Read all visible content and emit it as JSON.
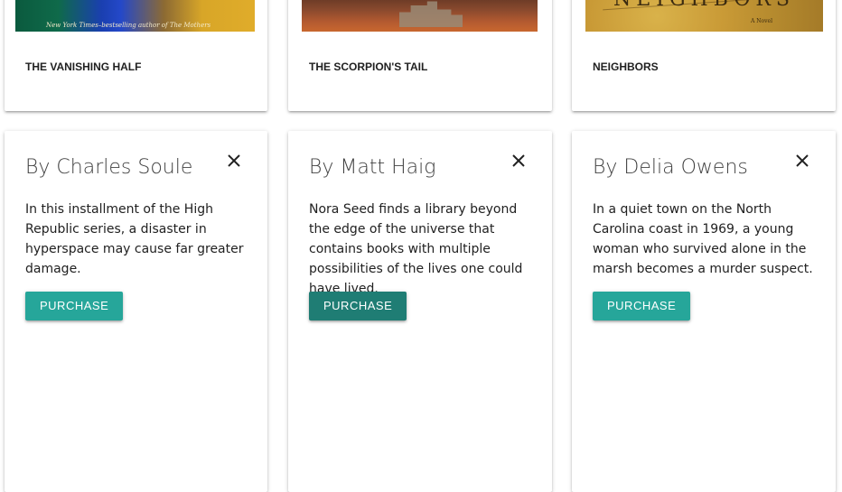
{
  "cards": [
    {
      "title": "THE VANISHING HALF",
      "cover_tagline": "New York Times–bestselling author of The Mothers",
      "author": "By Charles Soule",
      "description": "In this installment of the High Republic series, a disaster in hyperspace may cause far greater damage.",
      "purchase_label": "PURCHASE",
      "close_icon": "close-icon"
    },
    {
      "title": "THE SCORPION'S TAIL",
      "author": "By Matt Haig",
      "description": "Nora Seed finds a library beyond the edge of the universe that contains books with multiple possibilities of the lives one could have lived.",
      "purchase_label": "PURCHASE",
      "close_icon": "close-icon"
    },
    {
      "title": "NEIGHBORS",
      "cover_title": "NEIGHBORS",
      "cover_subtitle": "A Novel",
      "author": "By Delia Owens",
      "description": "In a quiet town on the North Carolina coast in 1969, a young woman who survived alone in the marsh becomes a murder suspect.",
      "purchase_label": "PURCHASE",
      "close_icon": "close-icon"
    }
  ],
  "colors": {
    "button": "#26a69a",
    "button_hover": "#1f7d74"
  }
}
